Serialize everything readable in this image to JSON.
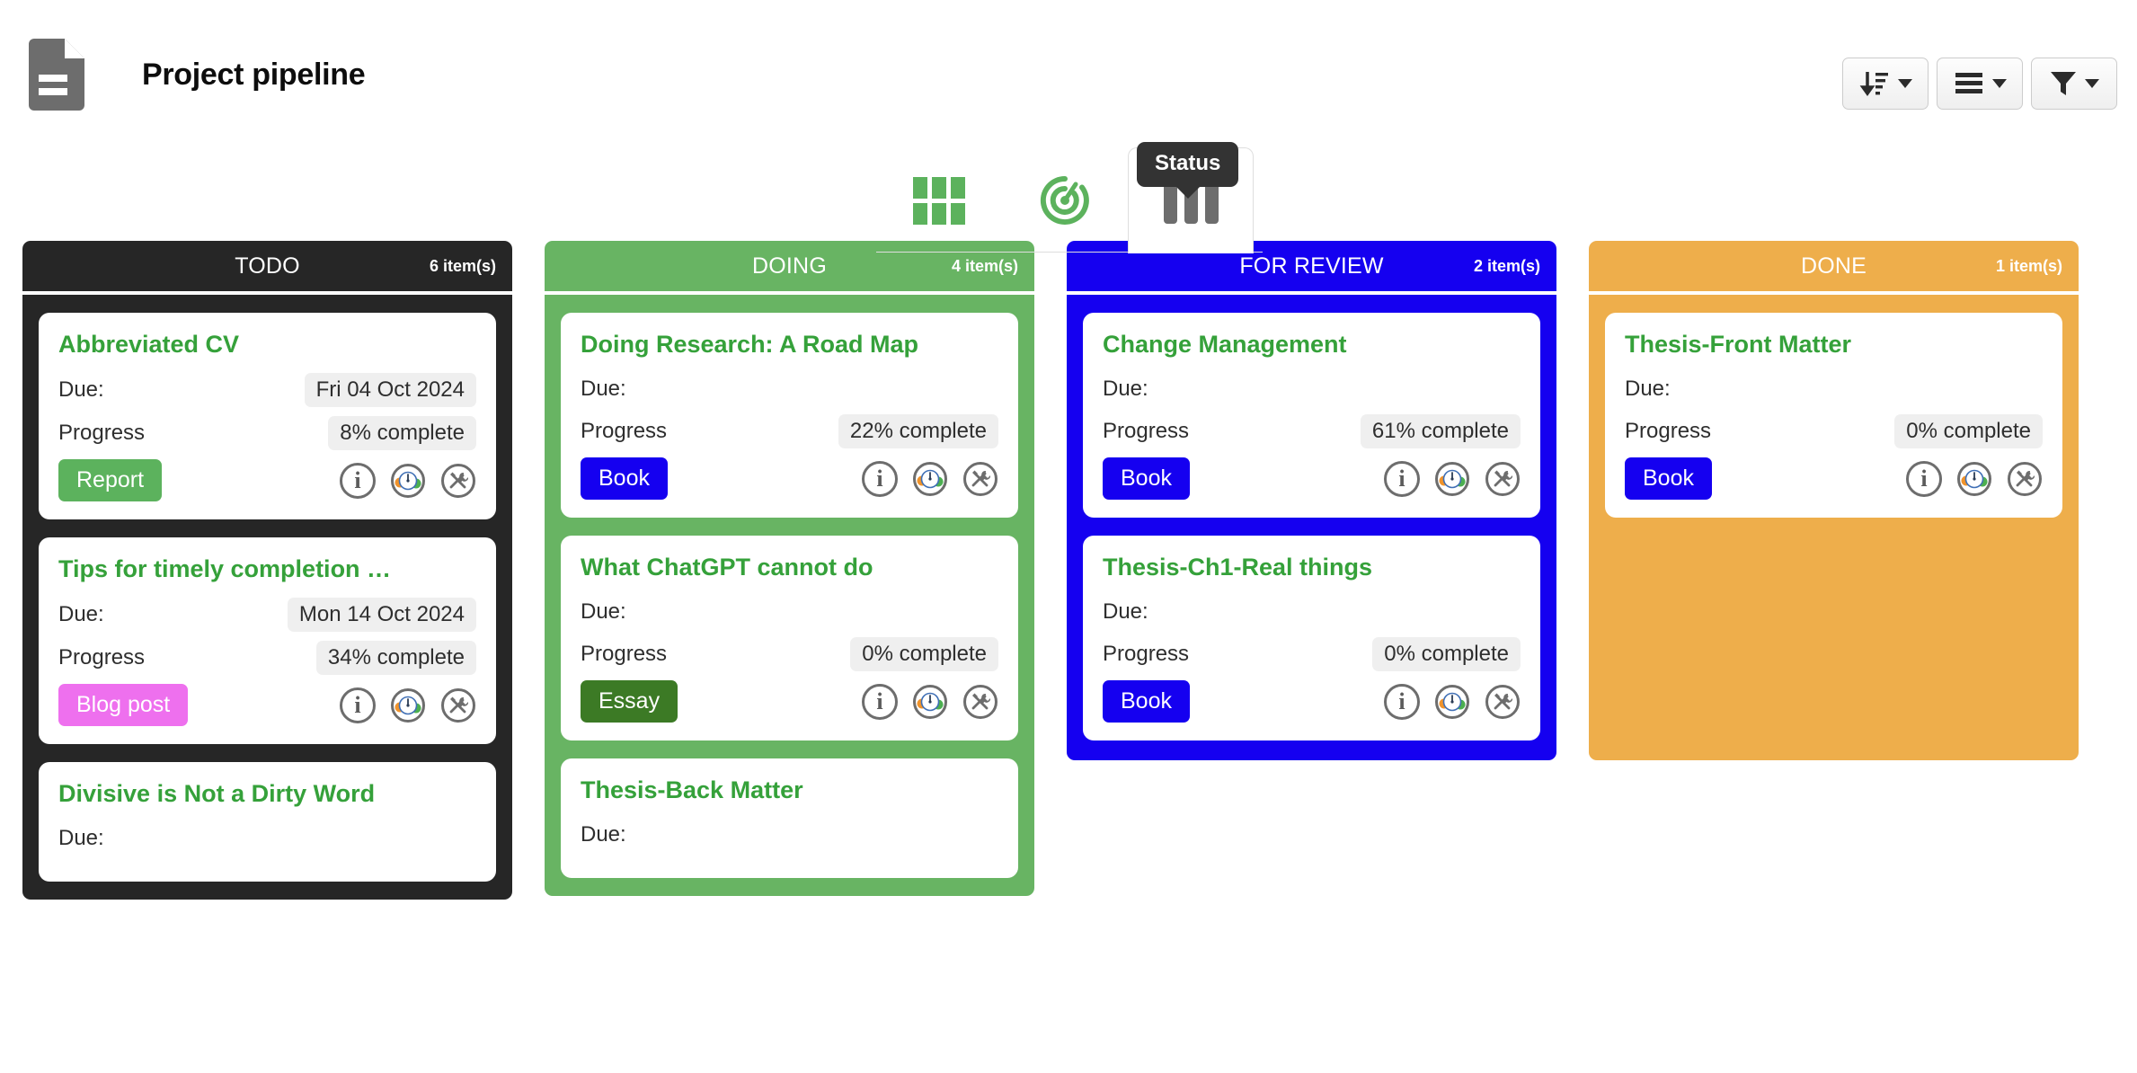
{
  "header": {
    "title": "Project pipeline",
    "doc_icon": "document-icon",
    "tools": [
      {
        "name": "sort-dropdown",
        "icon": "sort-descending-icon",
        "label": ""
      },
      {
        "name": "group-dropdown",
        "icon": "list-lines-icon",
        "label": ""
      },
      {
        "name": "filter-dropdown",
        "icon": "funnel-filter-icon",
        "label": ""
      }
    ]
  },
  "view_tabs": {
    "tooltip": "Status",
    "items": [
      {
        "name": "tab-grid",
        "icon": "grid-view-icon",
        "active": false
      },
      {
        "name": "tab-radar",
        "icon": "radar-progress-icon",
        "active": false
      },
      {
        "name": "tab-status",
        "icon": "columns-view-icon",
        "active": true
      }
    ]
  },
  "board": {
    "columns": [
      {
        "title": "TODO",
        "count": "6 item(s)",
        "color": "#262626",
        "cards": [
          {
            "title": "Abbreviated CV",
            "due_label": "Due:",
            "due_value": "Fri 04 Oct 2024",
            "progress_label": "Progress",
            "progress_value": "8% complete",
            "tag": "Report",
            "tag_color": "#5cb25d"
          },
          {
            "title": "Tips for timely completion …",
            "due_label": "Due:",
            "due_value": "Mon 14 Oct 2024",
            "progress_label": "Progress",
            "progress_value": "34% complete",
            "tag": "Blog post",
            "tag_color": "#ee70ee"
          },
          {
            "title": "Divisive is Not a Dirty Word",
            "due_label": "Due:",
            "due_value": "",
            "progress_label": "",
            "progress_value": "",
            "tag": "",
            "tag_color": ""
          }
        ]
      },
      {
        "title": "DOING",
        "count": "4 item(s)",
        "color": "#68b463",
        "cards": [
          {
            "title": "Doing Research: A Road Map",
            "due_label": "Due:",
            "due_value": "",
            "progress_label": "Progress",
            "progress_value": "22% complete",
            "tag": "Book",
            "tag_color": "#1500f0"
          },
          {
            "title": "What ChatGPT cannot do",
            "due_label": "Due:",
            "due_value": "",
            "progress_label": "Progress",
            "progress_value": "0% complete",
            "tag": "Essay",
            "tag_color": "#3c7a25"
          },
          {
            "title": "Thesis-Back Matter",
            "due_label": "Due:",
            "due_value": "",
            "progress_label": "",
            "progress_value": "",
            "tag": "",
            "tag_color": ""
          }
        ]
      },
      {
        "title": "FOR REVIEW",
        "count": "2 item(s)",
        "color": "#1500f0",
        "cards": [
          {
            "title": "Change Management",
            "due_label": "Due:",
            "due_value": "",
            "progress_label": "Progress",
            "progress_value": "61% complete",
            "tag": "Book",
            "tag_color": "#1500f0"
          },
          {
            "title": "Thesis-Ch1-Real things",
            "due_label": "Due:",
            "due_value": "",
            "progress_label": "Progress",
            "progress_value": "0% complete",
            "tag": "Book",
            "tag_color": "#1500f0"
          }
        ]
      },
      {
        "title": "DONE",
        "count": "1 item(s)",
        "color": "#eeae4b",
        "cards": [
          {
            "title": "Thesis-Front Matter",
            "due_label": "Due:",
            "due_value": "",
            "progress_label": "Progress",
            "progress_value": "0% complete",
            "tag": "Book",
            "tag_color": "#1500f0"
          }
        ]
      }
    ],
    "card_icons": [
      {
        "name": "info-icon",
        "glyph": "i"
      },
      {
        "name": "gauge-progress-icon",
        "glyph": ""
      },
      {
        "name": "tools-settings-icon",
        "glyph": ""
      }
    ],
    "title_color": "#35a13a"
  }
}
